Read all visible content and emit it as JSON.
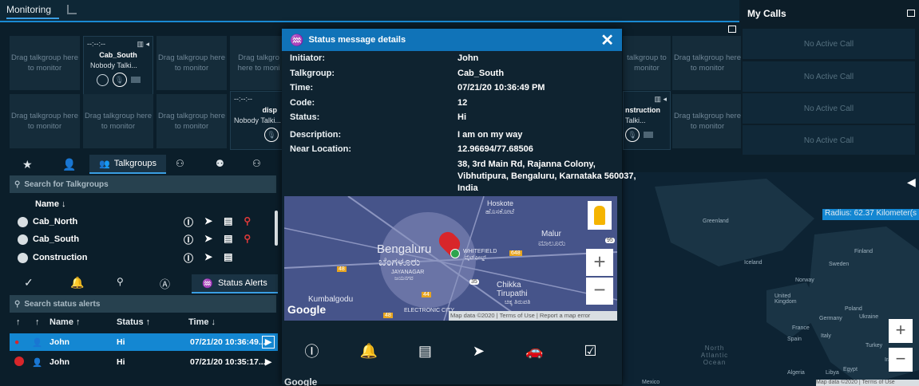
{
  "monitoring": {
    "title": "Monitoring",
    "drag_text": "Drag talkgroup here to monitor",
    "active_tiles": [
      {
        "time": "--:--:--",
        "name": "Cab_South",
        "status": "Nobody Talki..."
      },
      {
        "time": "--:--:--",
        "name": "disp",
        "status": "Nobody Talki..."
      },
      {
        "time": "",
        "name": "nstruction",
        "status": "Talki..."
      }
    ],
    "partial_tile_text": "Drag talkgro here to moni",
    "partial_right_text": "talkgroup to monitor"
  },
  "my_calls": {
    "title": "My Calls",
    "rows": [
      "No Active Call",
      "No Active Call",
      "No Active Call",
      "No Active Call"
    ]
  },
  "talkgroups": {
    "tab_label": "Talkgroups",
    "search_placeholder": "Search for Talkgroups",
    "col_name": "Name ↓",
    "rows": [
      {
        "name": "Cab_North"
      },
      {
        "name": "Cab_South"
      },
      {
        "name": "Construction"
      }
    ]
  },
  "status_alerts": {
    "tab_label": "Status Alerts",
    "search_placeholder": "Search status alerts",
    "col_name": "Name ↑",
    "col_status": "Status ↑",
    "col_time": "Time ↓",
    "rows": [
      {
        "name": "John",
        "status": "Hi",
        "time": "07/21/20 10:36:49..."
      },
      {
        "name": "John",
        "status": "Hi",
        "time": "07/21/20 10:35:17..."
      }
    ]
  },
  "dialog": {
    "title": "Status message details",
    "fields": [
      {
        "label": "Initiator:",
        "value": "John"
      },
      {
        "label": "Talkgroup:",
        "value": "Cab_South"
      },
      {
        "label": "Time:",
        "value": "07/21/20 10:36:49 PM"
      },
      {
        "label": "Code:",
        "value": "12"
      },
      {
        "label": "Status:",
        "value": "Hi"
      },
      {
        "label": "Description:",
        "value": "I am on my way"
      },
      {
        "label": "Near Location:",
        "value": "12.96694/77.68506"
      }
    ],
    "address_lines": [
      "38, 3rd Main Rd, Rajanna Colony,",
      "Vibhutipura, Bengaluru, Karnataka 560037,",
      "India"
    ],
    "map": {
      "labels": [
        "Hoskote",
        "ಹೊಸಕೋಟೆ",
        "Bengaluru",
        "ಬೆಂಗಳೂರು",
        "WHITEFIELD",
        "ವೈಟ್‌ಫೀಲ್ಡ್",
        "JAYANAGAR",
        "ಜಯನಗರ",
        "Malur",
        "ಮಾಲೂರು",
        "Chikka Tirupathi",
        "ಚಿಕ್ಕ ತಿರುಪತಿ",
        "Kumbalgodu",
        "ELECTRONIC CITY",
        "Google"
      ],
      "road_badges": [
        "648",
        "48",
        "35",
        "44",
        "95",
        "48"
      ],
      "attribution": "Map data ©2020",
      "terms": "Terms of Use",
      "report": "Report a map error"
    }
  },
  "world_map": {
    "radius_label": "Radius: 62.37 Kilometer(s",
    "labels": [
      "Greenland",
      "Iceland",
      "Sweden",
      "Finland",
      "Norway",
      "United Kingdom",
      "Poland",
      "Germany",
      "Ukraine",
      "France",
      "Italy",
      "Spain",
      "Turkey",
      "Iraq",
      "Algeria",
      "Libya",
      "Egypt",
      "North Atlantic Ocean",
      "Mexico"
    ],
    "attribution": "Map data ©2020",
    "terms": "Terms of Use"
  },
  "colors": {
    "accent": "#1487d2",
    "header": "#1073b8",
    "alert_red": "#d8262a"
  }
}
